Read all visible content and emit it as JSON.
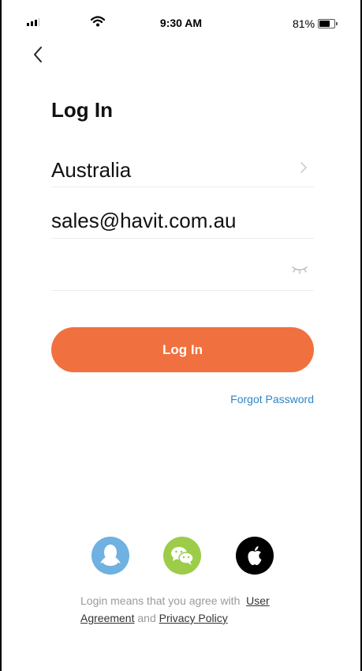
{
  "status_bar": {
    "time": "9:30 AM",
    "battery_percent": "81%",
    "battery_level": 0.81,
    "signal_icon": "signal-bars-icon",
    "wifi_icon": "wifi-icon"
  },
  "nav": {
    "back_icon": "chevron-left-icon"
  },
  "page": {
    "title": "Log In"
  },
  "form": {
    "country": "Australia",
    "account": "sales@havit.com.au",
    "password": "",
    "country_chevron_icon": "chevron-right-icon",
    "password_toggle_icon": "eye-closed-icon"
  },
  "actions": {
    "login_label": "Log In",
    "forgot_label": "Forgot Password"
  },
  "social": [
    {
      "name": "qq",
      "icon": "qq-penguin-icon",
      "color": "#6fb1e0"
    },
    {
      "name": "wechat",
      "icon": "wechat-icon",
      "color": "#9ccc49"
    },
    {
      "name": "apple",
      "icon": "apple-icon",
      "color": "#000000"
    }
  ],
  "legal": {
    "prefix": "Login means that you agree with",
    "user_agreement": "User Agreement",
    "and": "and",
    "privacy_policy": "Privacy Policy"
  },
  "colors": {
    "accent": "#f0713f",
    "link": "#2f84c7"
  }
}
